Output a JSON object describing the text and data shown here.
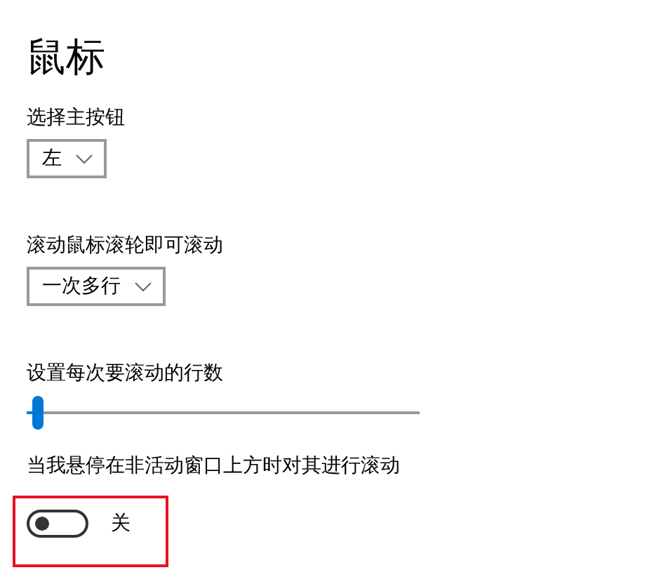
{
  "title": "鼠标",
  "settings": [
    {
      "kind": "dropdown",
      "label": "选择主按钮",
      "value": "左"
    },
    {
      "kind": "dropdown",
      "label": "滚动鼠标滚轮即可滚动",
      "value": "一次多行"
    },
    {
      "kind": "slider",
      "label": "设置每次要滚动的行数",
      "level": 0.03
    },
    {
      "kind": "toggle",
      "label": "当我悬停在非活动窗口上方时对其进行滚动",
      "on": false,
      "state_text": "关",
      "highlighted": true
    }
  ]
}
